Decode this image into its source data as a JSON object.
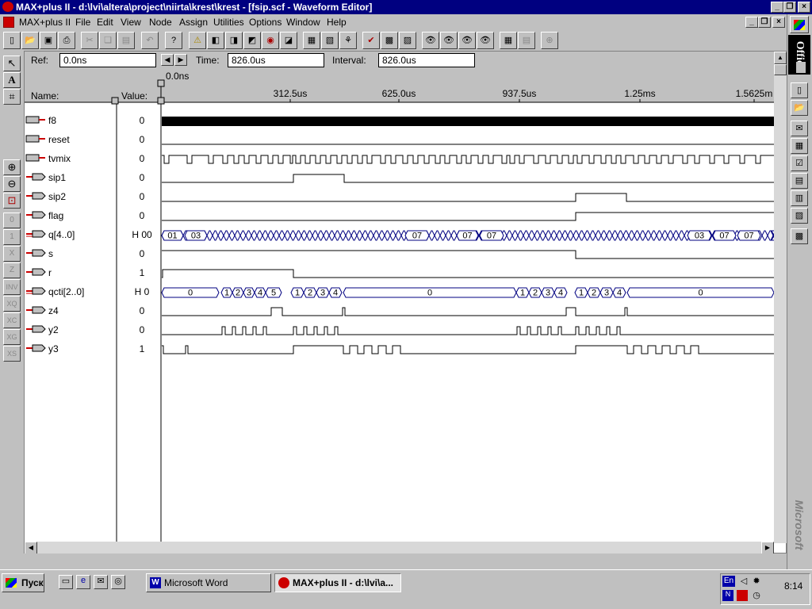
{
  "window": {
    "title": "MAX+plus II - d:\\lvi\\altera\\project\\niirta\\krest\\krest - [fsip.scf - Waveform Editor]",
    "minimize": "_",
    "restore": "❐",
    "close": "×"
  },
  "menu": [
    "MAX+plus II",
    "File",
    "Edit",
    "View",
    "Node",
    "Assign",
    "Utilities",
    "Options",
    "Window",
    "Help"
  ],
  "header": {
    "ref_label": "Ref:",
    "ref_value": "0.0ns",
    "time_label": "Time:",
    "time_value": "826.0us",
    "interval_label": "Interval:",
    "interval_value": "826.0us",
    "cursor_label": "0.0ns",
    "name_col": "Name:",
    "value_col": "Value:"
  },
  "timescale": {
    "ticks": [
      "312.5us",
      "625.0us",
      "937.5us",
      "1.25ms",
      "1.5625m"
    ]
  },
  "signals": [
    {
      "name": "f8",
      "value": "0",
      "kind": "input"
    },
    {
      "name": "reset",
      "value": "0",
      "kind": "input"
    },
    {
      "name": "tvmix",
      "value": "0",
      "kind": "input"
    },
    {
      "name": "sip1",
      "value": "0",
      "kind": "output"
    },
    {
      "name": "sip2",
      "value": "0",
      "kind": "output"
    },
    {
      "name": "flag",
      "value": "0",
      "kind": "output"
    },
    {
      "name": "q[4..0]",
      "value": "H 00",
      "kind": "bus"
    },
    {
      "name": "s",
      "value": "0",
      "kind": "output"
    },
    {
      "name": "r",
      "value": "1",
      "kind": "output"
    },
    {
      "name": "qcti[2..0]",
      "value": "H 0",
      "kind": "bus"
    },
    {
      "name": "z4",
      "value": "0",
      "kind": "output"
    },
    {
      "name": "y2",
      "value": "0",
      "kind": "output"
    },
    {
      "name": "y3",
      "value": "1",
      "kind": "output"
    }
  ],
  "bus_labels": {
    "q": [
      "01",
      "03",
      "03",
      "07",
      "07",
      "07",
      "03",
      "07",
      "07"
    ],
    "qcti": [
      "0",
      "1",
      "2",
      "3",
      "4",
      "5",
      "1",
      "2",
      "3",
      "4",
      "0",
      "1",
      "2",
      "3",
      "4",
      "1",
      "2",
      "3",
      "4",
      "0"
    ]
  },
  "taskbar": {
    "start": "Пуск",
    "tasks": [
      "Microsoft Word",
      "MAX+plus II - d:\\lvi\\a..."
    ],
    "tray_lang": "En",
    "clock": "8:14"
  },
  "office": {
    "label": "Office",
    "brand": "Microsoft"
  },
  "colors": {
    "titlebar": "#000080",
    "bus": "#000080",
    "wave": "#000000"
  }
}
